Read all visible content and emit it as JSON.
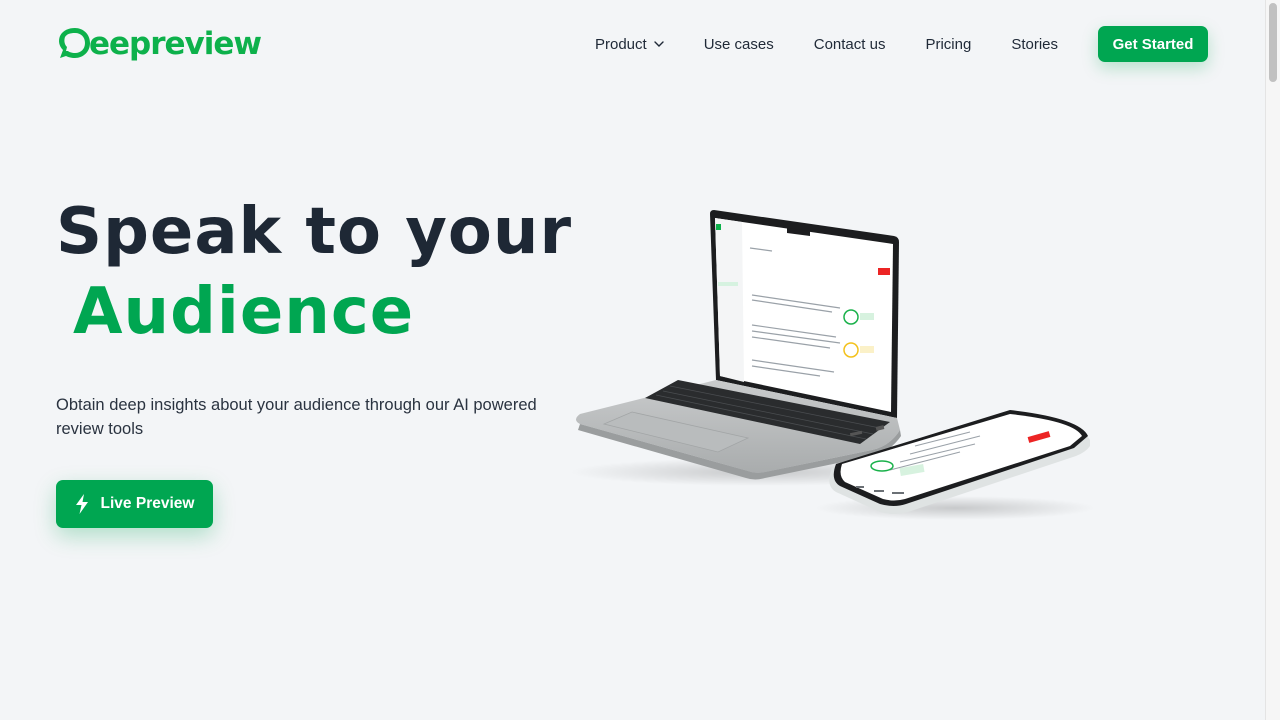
{
  "brand": {
    "name": "Deepreview",
    "logo_text": "eepreview",
    "color": "#0db14b"
  },
  "nav": {
    "items": [
      {
        "label": "Product",
        "has_dropdown": true
      },
      {
        "label": "Use cases"
      },
      {
        "label": "Contact us"
      },
      {
        "label": "Pricing"
      },
      {
        "label": "Stories"
      }
    ],
    "cta_label": "Get Started"
  },
  "hero": {
    "title_line1": "Speak to your",
    "title_line2": "Audience",
    "subtitle": "Obtain deep insights about your audience through our AI powered review tools",
    "button_label": "Live Preview",
    "button_icon": "lightning-bolt-icon",
    "accent_color": "#00a651",
    "illustration": "laptop-and-phone-app-preview"
  }
}
